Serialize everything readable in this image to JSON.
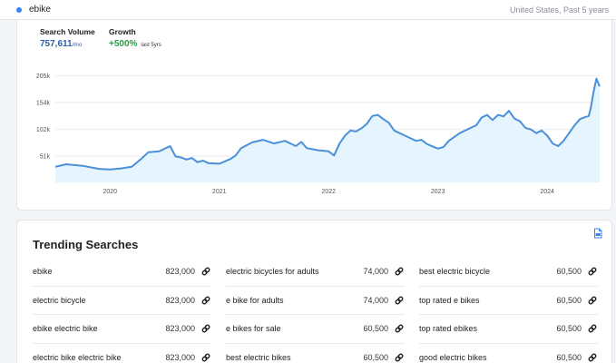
{
  "header": {
    "keyword": "ebike",
    "location": "United States, Past 5 years"
  },
  "metrics": {
    "search_volume_label": "Search Volume",
    "search_volume_value": "757,611",
    "search_volume_unit": "/mo",
    "growth_label": "Growth",
    "growth_value": "+500%",
    "growth_sub": "last 5yrs"
  },
  "chart_data": {
    "type": "area",
    "y_ticks": [
      51000,
      102000,
      154000,
      205000
    ],
    "y_tick_labels": [
      "51k",
      "102k",
      "154k",
      "205k"
    ],
    "ylim": [
      0,
      215000
    ],
    "x_ticks": [
      2020,
      2021,
      2022,
      2023,
      2024
    ],
    "x_tick_labels": [
      "2020",
      "2021",
      "2022",
      "2023",
      "2024"
    ],
    "xlim": [
      2019.5,
      2024.48
    ],
    "grid": true,
    "series": [
      {
        "color": "#4a90d9",
        "x": [
          2019.5,
          2019.6,
          2019.75,
          2019.9,
          2020.0,
          2020.1,
          2020.2,
          2020.3,
          2020.35,
          2020.45,
          2020.55,
          2020.6,
          2020.65,
          2020.7,
          2020.75,
          2020.8,
          2020.85,
          2020.9,
          2021.0,
          2021.1,
          2021.15,
          2021.2,
          2021.3,
          2021.4,
          2021.5,
          2021.6,
          2021.7,
          2021.75,
          2021.8,
          2021.9,
          2022.0,
          2022.05,
          2022.1,
          2022.15,
          2022.2,
          2022.25,
          2022.3,
          2022.35,
          2022.4,
          2022.45,
          2022.5,
          2022.55,
          2022.6,
          2022.65,
          2022.7,
          2022.75,
          2022.8,
          2022.85,
          2022.9,
          2023.0,
          2023.05,
          2023.1,
          2023.2,
          2023.3,
          2023.35,
          2023.4,
          2023.45,
          2023.5,
          2023.55,
          2023.6,
          2023.65,
          2023.7,
          2023.75,
          2023.8,
          2023.85,
          2023.9,
          2023.95,
          2024.0,
          2024.05,
          2024.1,
          2024.15,
          2024.2,
          2024.25,
          2024.3,
          2024.35,
          2024.38,
          2024.4,
          2024.42,
          2024.45,
          2024.48
        ],
        "y": [
          30000,
          35000,
          32000,
          26000,
          25000,
          27000,
          30000,
          48000,
          58000,
          60000,
          70000,
          50000,
          48000,
          44000,
          47000,
          39000,
          42000,
          37000,
          36000,
          45000,
          52000,
          66000,
          77000,
          82000,
          75000,
          80000,
          70000,
          78000,
          66000,
          62000,
          60000,
          52000,
          75000,
          90000,
          100000,
          98000,
          104000,
          113000,
          128000,
          130000,
          122000,
          115000,
          100000,
          95000,
          90000,
          85000,
          80000,
          82000,
          74000,
          65000,
          68000,
          80000,
          95000,
          105000,
          110000,
          125000,
          130000,
          120000,
          130000,
          127000,
          138000,
          123000,
          118000,
          105000,
          102000,
          95000,
          100000,
          90000,
          75000,
          70000,
          80000,
          95000,
          110000,
          122000,
          126000,
          128000,
          145000,
          170000,
          200000,
          185000
        ]
      }
    ]
  },
  "trending": {
    "title": "Trending Searches",
    "rows": [
      [
        {
          "term": "ebike",
          "volume": "823,000"
        },
        {
          "term": "electric bicycles for adults",
          "volume": "74,000"
        },
        {
          "term": "best electric bicycle",
          "volume": "60,500"
        }
      ],
      [
        {
          "term": "electric bicycle",
          "volume": "823,000"
        },
        {
          "term": "e bike for adults",
          "volume": "74,000"
        },
        {
          "term": "top rated e bikes",
          "volume": "60,500"
        }
      ],
      [
        {
          "term": "ebike electric bike",
          "volume": "823,000"
        },
        {
          "term": "e bikes for sale",
          "volume": "60,500"
        },
        {
          "term": "top rated ebikes",
          "volume": "60,500"
        }
      ],
      [
        {
          "term": "electric bike electric bike",
          "volume": "823,000"
        },
        {
          "term": "best electric bikes",
          "volume": "60,500"
        },
        {
          "term": "good electric bikes",
          "volume": "60,500"
        }
      ]
    ]
  },
  "icons": {
    "row_link": "link-icon",
    "export": "export-icon"
  }
}
